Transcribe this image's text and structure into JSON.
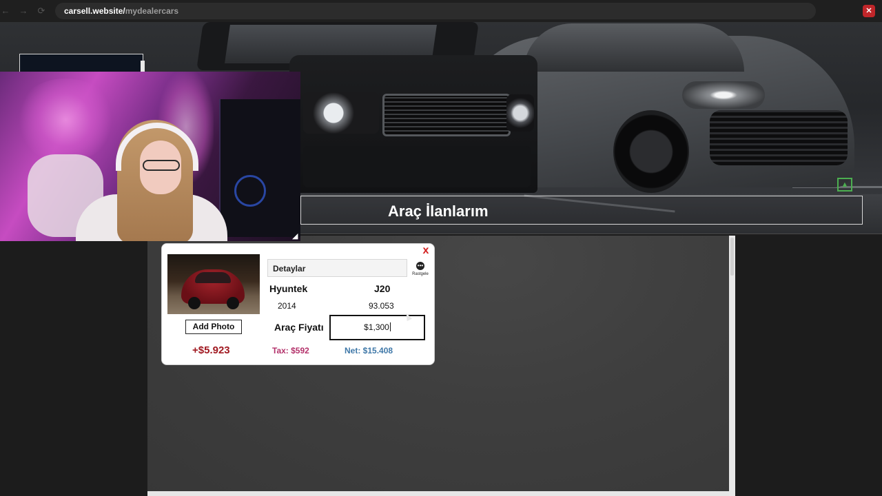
{
  "browser": {
    "back_icon": "arrow-left-icon",
    "forward_icon": "arrow-right-icon",
    "reload_icon": "reload-icon",
    "url_host": "carsell.website/",
    "url_path": "mydealercars",
    "close_label": "✕"
  },
  "hero": {
    "title": "Araç İlanlarım",
    "image_icon": "image-icon"
  },
  "listing": {
    "close_label": "x",
    "details_placeholder": "Detaylar",
    "random_label": "Rastgele",
    "brand": "Hyuntek",
    "model": "J20",
    "year": "2014",
    "mileage": "93.053",
    "add_photo_label": "Add Photo",
    "price_label": "Araç Fiyatı",
    "price_value": "$1,300",
    "profit": "+$5.923",
    "tax": "Tax: $592",
    "net": "Net: $15.408"
  },
  "colors": {
    "profit": "#a01820",
    "tax": "#b3316a",
    "net": "#3f78a8",
    "close": "#d32020"
  }
}
